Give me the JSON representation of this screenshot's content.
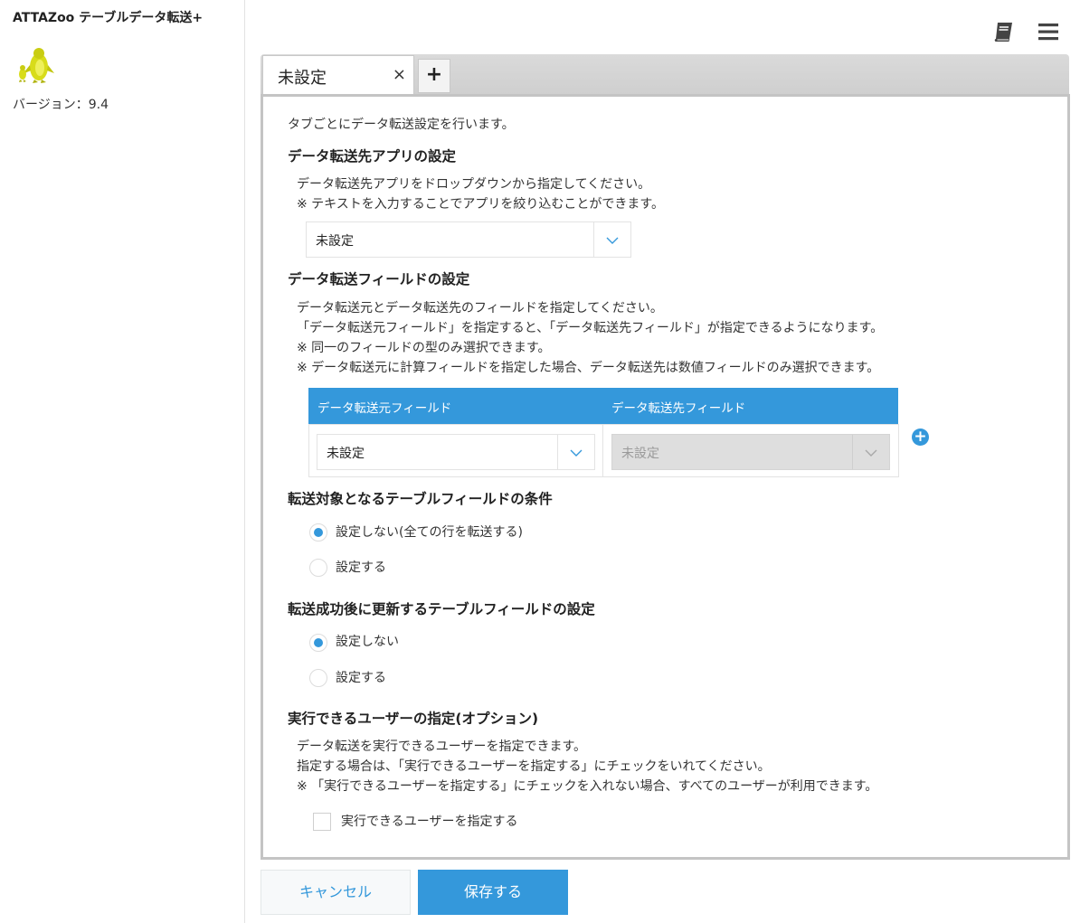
{
  "sidebar": {
    "app_title": "ATTAZoo テーブルデータ転送+",
    "version": "バージョン：9.4"
  },
  "header": {
    "icons": [
      "book-icon",
      "hamburger-menu-icon"
    ]
  },
  "tabs": {
    "active_label": "未設定",
    "close_glyph": "×",
    "add_glyph": "+"
  },
  "panel": {
    "intro": "タブごとにデータ転送設定を行います。",
    "dest_app": {
      "heading": "データ転送先アプリの設定",
      "desc1": "データ転送先アプリをドロップダウンから指定してください。",
      "desc2": "※ テキストを入力することでアプリを絞り込むことができます。",
      "select_value": "未設定"
    },
    "fields": {
      "heading": "データ転送フィールドの設定",
      "desc1": "データ転送元とデータ転送先のフィールドを指定してください。",
      "desc2": "「データ転送元フィールド」を指定すると、「データ転送先フィールド」が指定できるようになります。",
      "desc3": "※ 同一のフィールドの型のみ選択できます。",
      "desc4": "※ データ転送元に計算フィールドを指定した場合、データ転送先は数値フィールドのみ選択できます。",
      "col_source": "データ転送元フィールド",
      "col_dest": "データ転送先フィールド",
      "source_value": "未設定",
      "dest_value": "未設定",
      "add_glyph": "+"
    },
    "condition": {
      "heading": "転送対象となるテーブルフィールドの条件",
      "options": [
        "設定しない(全ての行を転送する)",
        "設定する"
      ],
      "selected_index": 0
    },
    "update": {
      "heading": "転送成功後に更新するテーブルフィールドの設定",
      "options": [
        "設定しない",
        "設定する"
      ],
      "selected_index": 0
    },
    "users": {
      "heading": "実行できるユーザーの指定(オプション)",
      "desc1": "データ転送を実行できるユーザーを指定できます。",
      "desc2": "指定する場合は、「実行できるユーザーを指定する」にチェックをいれてください。",
      "desc3": "※ 「実行できるユーザーを指定する」にチェックを入れない場合、すべてのユーザーが利用できます。",
      "checkbox_label": "実行できるユーザーを指定する",
      "checked": false
    }
  },
  "footer": {
    "cancel_label": "キャンセル",
    "save_label": "保存する"
  },
  "colors": {
    "accent": "#3498db",
    "logo": "#d8dc1a"
  }
}
